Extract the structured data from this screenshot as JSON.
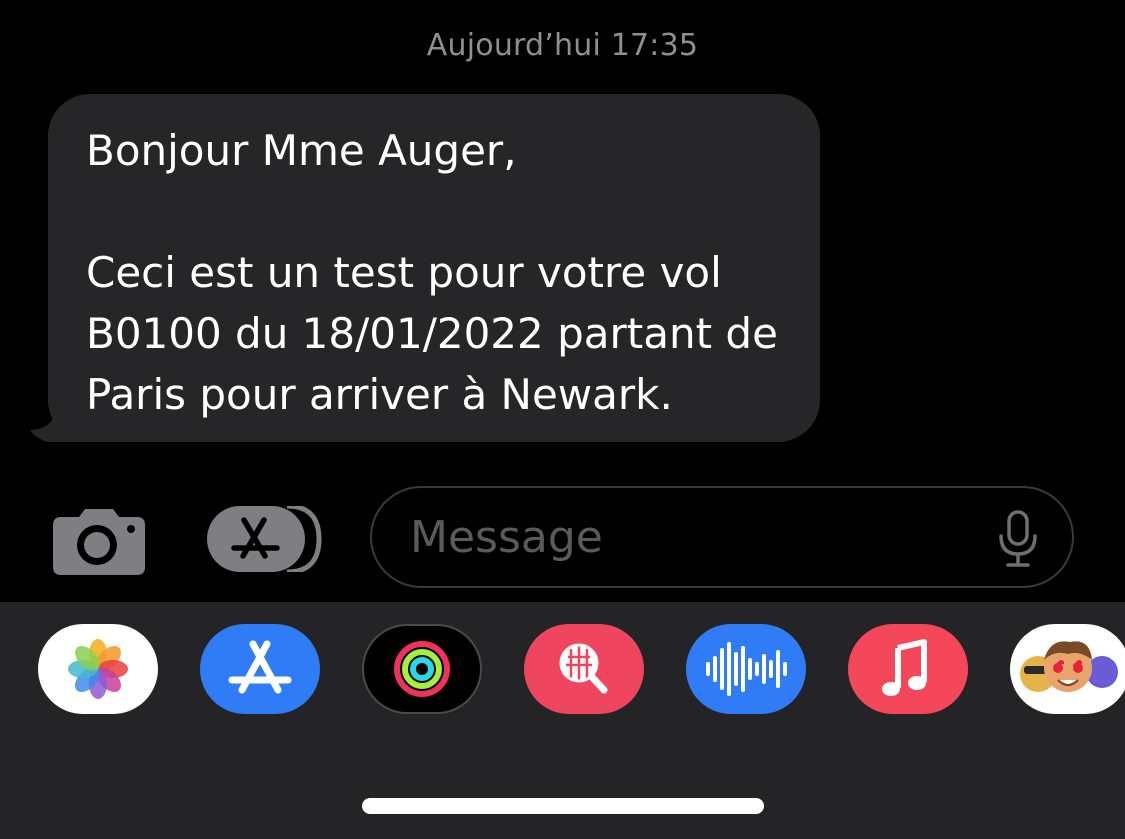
{
  "conversation": {
    "timestamp": "Aujourd’hui 17:35",
    "messages": [
      {
        "direction": "incoming",
        "text": "Bonjour Mme Auger,\n\nCeci est un test pour votre vol B0100 du 18/01/2022 partant de Paris pour arriver à Newark."
      }
    ]
  },
  "compose": {
    "camera_icon": "camera-icon",
    "apps_icon": "app-store-icon",
    "placeholder": "Message",
    "mic_icon": "microphone-icon"
  },
  "app_tray": {
    "apps": [
      {
        "id": "photos",
        "icon": "photos-icon"
      },
      {
        "id": "app-store",
        "icon": "app-store-icon"
      },
      {
        "id": "activity",
        "icon": "activity-rings-icon"
      },
      {
        "id": "images-search",
        "icon": "globe-search-icon"
      },
      {
        "id": "audio-message",
        "icon": "waveform-icon"
      },
      {
        "id": "music",
        "icon": "music-note-icon"
      },
      {
        "id": "memoji",
        "icon": "memoji-stickers-icon"
      }
    ]
  },
  "colors": {
    "background": "#000000",
    "bubble_incoming": "#262628",
    "tray_background": "#242426",
    "timestamp_text": "#8e8e93",
    "app_store_blue": "#2f7cf6",
    "search_red": "#f0455f",
    "music_red": "#f4485a"
  }
}
